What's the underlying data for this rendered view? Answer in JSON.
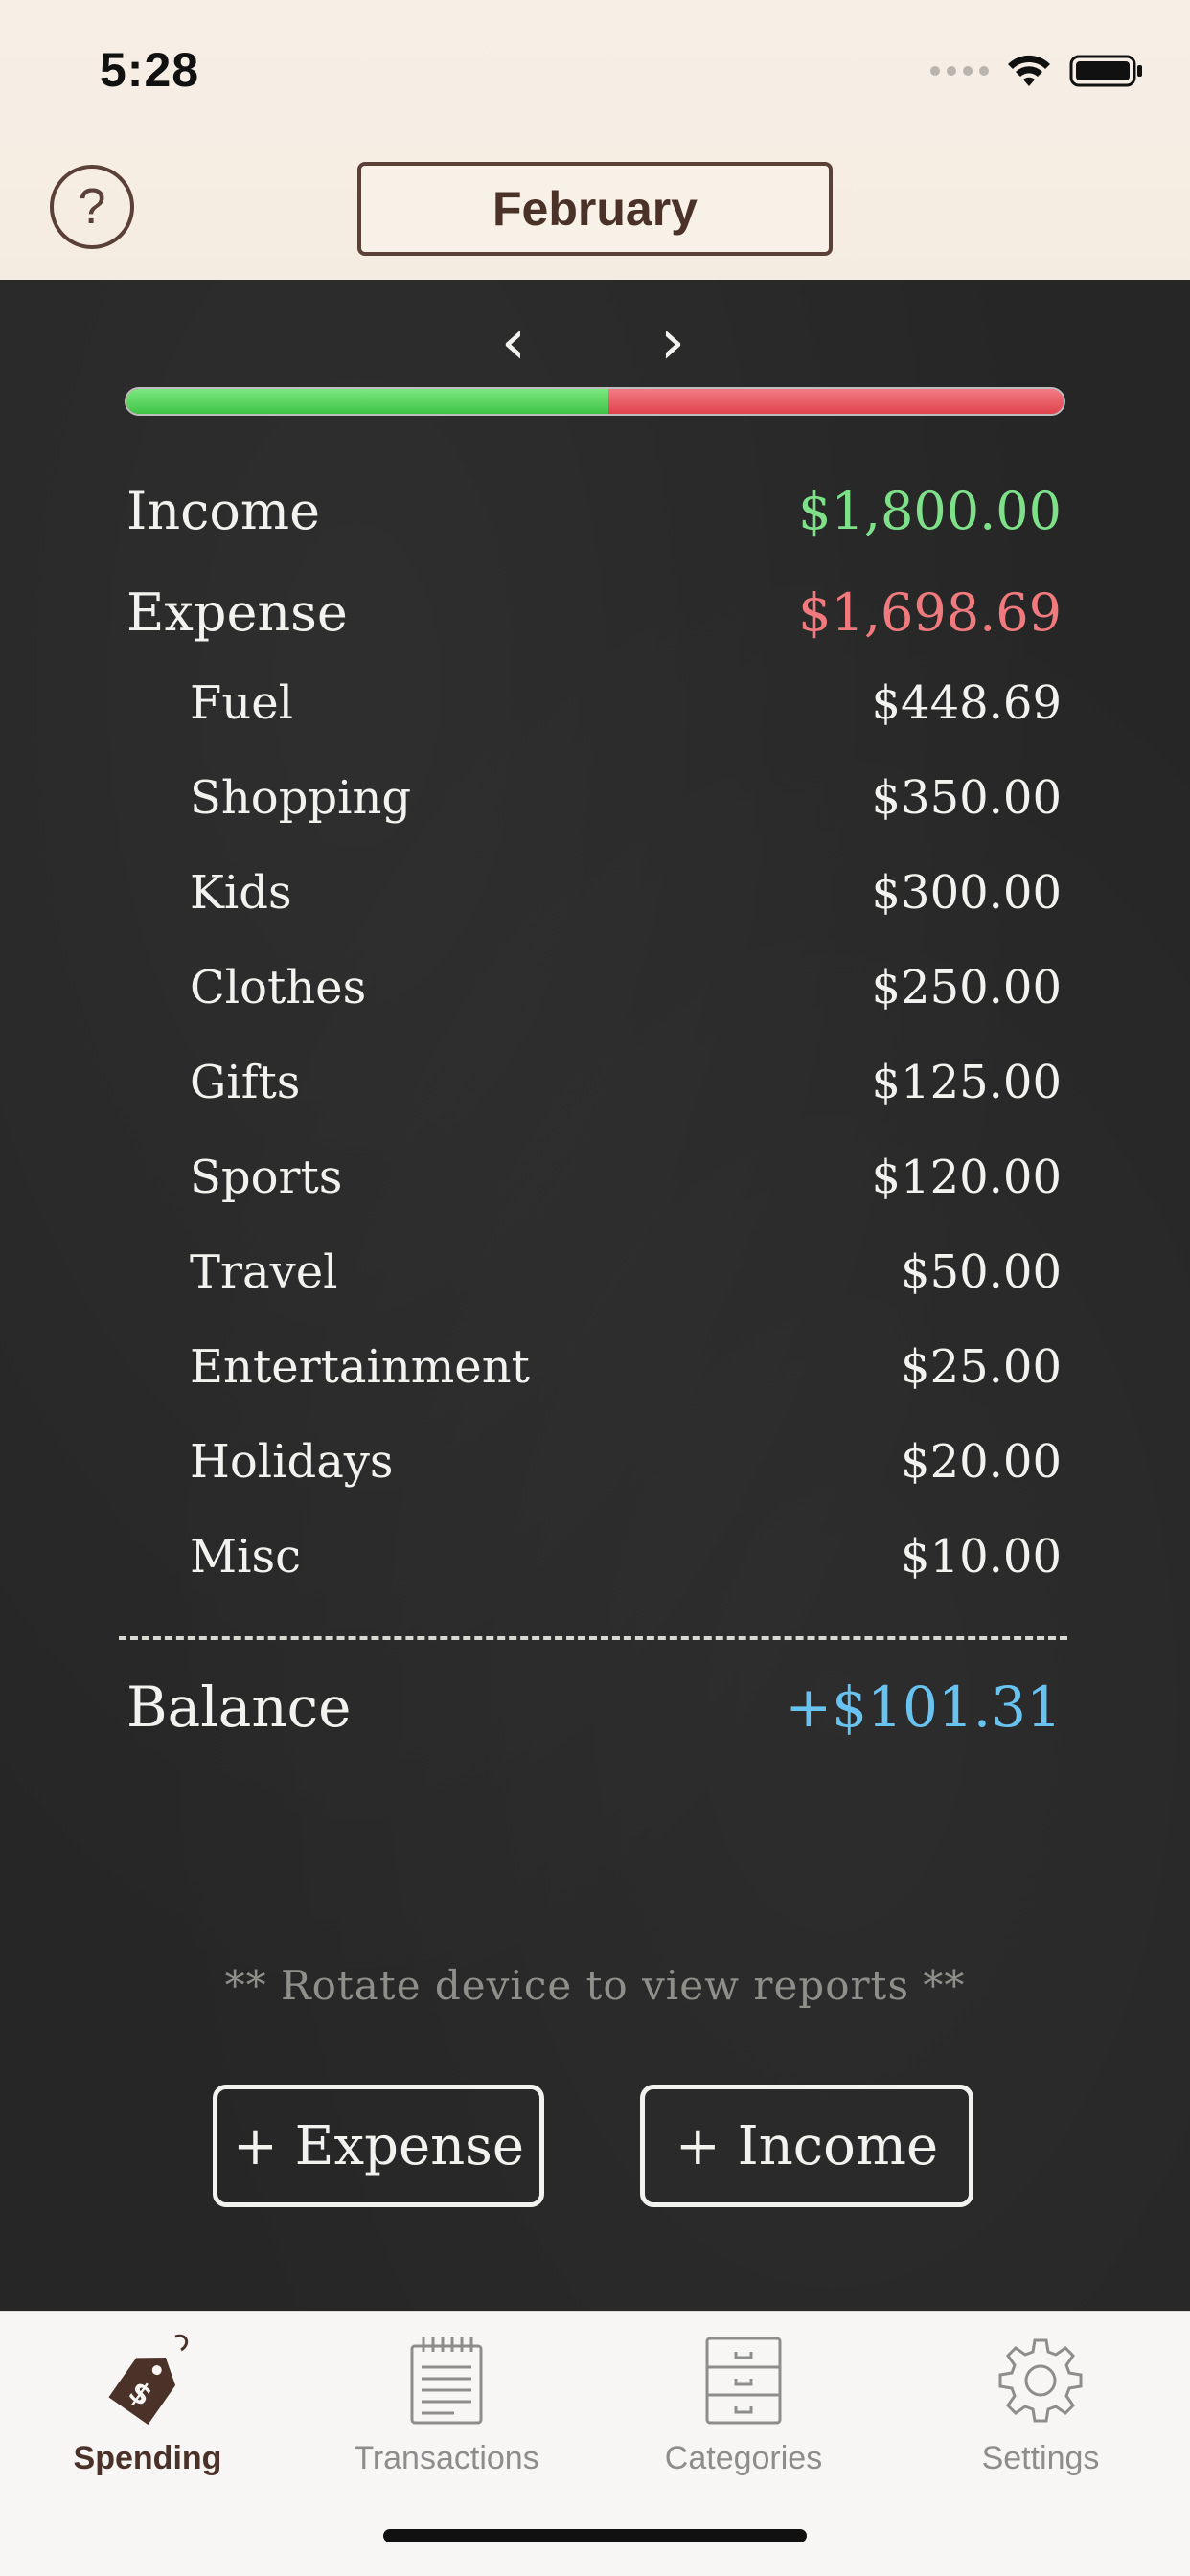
{
  "status": {
    "time": "5:28"
  },
  "header": {
    "help_label": "?",
    "month": "February"
  },
  "nav": {
    "prev": "‹",
    "next": "›"
  },
  "budget": {
    "spent_fraction": 0.514
  },
  "summary": {
    "income_label": "Income",
    "income_value": "$1,800.00",
    "expense_label": "Expense",
    "expense_value": "$1,698.69",
    "balance_label": "Balance",
    "balance_value": "+$101.31"
  },
  "categories": [
    {
      "name": "Fuel",
      "amount": "$448.69"
    },
    {
      "name": "Shopping",
      "amount": "$350.00"
    },
    {
      "name": "Kids",
      "amount": "$300.00"
    },
    {
      "name": "Clothes",
      "amount": "$250.00"
    },
    {
      "name": "Gifts",
      "amount": "$125.00"
    },
    {
      "name": "Sports",
      "amount": "$120.00"
    },
    {
      "name": "Travel",
      "amount": "$50.00"
    },
    {
      "name": "Entertainment",
      "amount": "$25.00"
    },
    {
      "name": "Holidays",
      "amount": "$20.00"
    },
    {
      "name": "Misc",
      "amount": "$10.00"
    }
  ],
  "actions": {
    "add_expense": "+ Expense",
    "add_income": "+ Income"
  },
  "hint": "** Rotate device to view reports **",
  "tabs": [
    {
      "label": "Spending",
      "icon": "price-tag-icon",
      "active": true
    },
    {
      "label": "Transactions",
      "icon": "notepad-icon",
      "active": false
    },
    {
      "label": "Categories",
      "icon": "file-cabinet-icon",
      "active": false
    },
    {
      "label": "Settings",
      "icon": "gear-icon",
      "active": false
    }
  ],
  "colors": {
    "income": "#7fe08a",
    "expense": "#f07a7d",
    "balance": "#69c3f0",
    "accent_brown": "#5a4036"
  }
}
